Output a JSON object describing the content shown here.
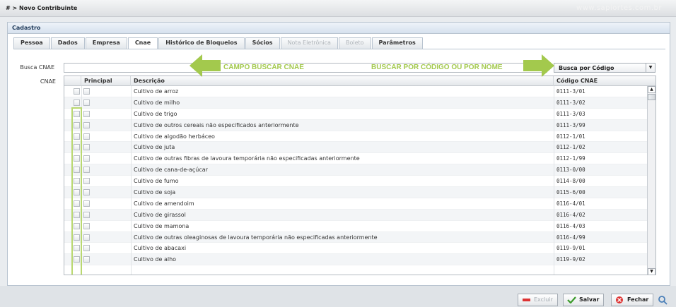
{
  "header": {
    "breadcrumb": "# > Novo Contribuinte",
    "watermark": "www.sapiortes.com.br"
  },
  "panel": {
    "title": "Cadastro"
  },
  "tabs": [
    {
      "label": "Pessoa",
      "state": "normal"
    },
    {
      "label": "Dados",
      "state": "normal"
    },
    {
      "label": "Empresa",
      "state": "normal"
    },
    {
      "label": "Cnae",
      "state": "active"
    },
    {
      "label": "Histórico de Bloqueios",
      "state": "normal"
    },
    {
      "label": "Sócios",
      "state": "normal"
    },
    {
      "label": "Nota Eletrônica",
      "state": "disabled"
    },
    {
      "label": "Boleto",
      "state": "disabled"
    },
    {
      "label": "Parâmetros",
      "state": "normal"
    }
  ],
  "form": {
    "search_label": "Busca CNAE",
    "search_value": "",
    "search_mode": "Busca por Código",
    "cnae_label": "CNAE"
  },
  "annotations": {
    "left": "CAMPO BUSCAR CNAE",
    "right": "BUSCAR POR CÓDIGO OU POR NOME",
    "color": "#a3c94d"
  },
  "grid": {
    "headers": {
      "principal": "Principal",
      "descricao": "Descrição",
      "codigo": "Código CNAE"
    },
    "rows": [
      {
        "descricao": "Cultivo de arroz",
        "codigo": "0111-3/01"
      },
      {
        "descricao": "Cultivo de milho",
        "codigo": "0111-3/02"
      },
      {
        "descricao": "Cultivo de trigo",
        "codigo": "0111-3/03"
      },
      {
        "descricao": "Cultivo de outros cereais não especificados anteriormente",
        "codigo": "0111-3/99"
      },
      {
        "descricao": "Cultivo de algodão herbáceo",
        "codigo": "0112-1/01"
      },
      {
        "descricao": "Cultivo de juta",
        "codigo": "0112-1/02"
      },
      {
        "descricao": "Cultivo de outras fibras de lavoura temporária não especificadas anteriormente",
        "codigo": "0112-1/99"
      },
      {
        "descricao": "Cultivo de cana-de-açúcar",
        "codigo": "0113-0/00"
      },
      {
        "descricao": "Cultivo de fumo",
        "codigo": "0114-8/00"
      },
      {
        "descricao": "Cultivo de soja",
        "codigo": "0115-6/00"
      },
      {
        "descricao": "Cultivo de amendoim",
        "codigo": "0116-4/01"
      },
      {
        "descricao": "Cultivo de girassol",
        "codigo": "0116-4/02"
      },
      {
        "descricao": "Cultivo de mamona",
        "codigo": "0116-4/03"
      },
      {
        "descricao": "Cultivo de outras oleaginosas de lavoura temporária não especificadas anteriormente",
        "codigo": "0116-4/99"
      },
      {
        "descricao": "Cultivo de abacaxi",
        "codigo": "0119-9/01"
      },
      {
        "descricao": "Cultivo de alho",
        "codigo": "0119-9/02"
      }
    ]
  },
  "footer": {
    "excluir": "Excluir",
    "salvar": "Salvar",
    "fechar": "Fechar"
  }
}
